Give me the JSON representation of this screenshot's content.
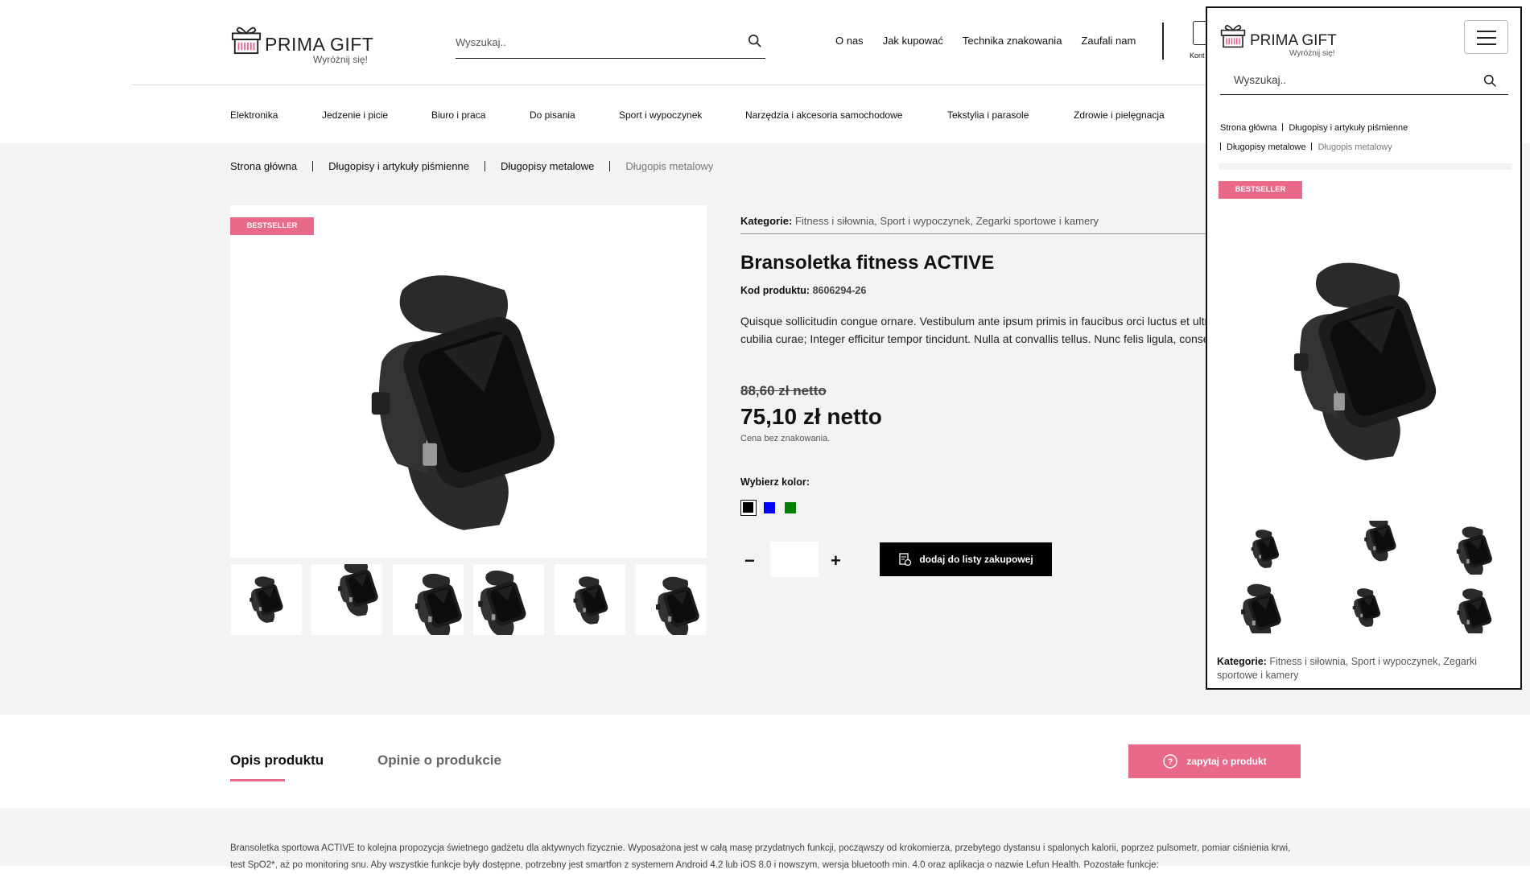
{
  "header": {
    "brand": "PRIMA GIFT",
    "tagline": "Wyróżnij się!",
    "search_placeholder": "Wyszukaj..",
    "nav": [
      "O nas",
      "Jak kupować",
      "Technika znakowania",
      "Zaufali nam"
    ],
    "cart_label": "Kont"
  },
  "categories_nav": [
    "Elektronika",
    "Jedzenie i picie",
    "Biuro i praca",
    "Do pisania",
    "Sport i wypoczynek",
    "Narzędzia i akcesoria samochodowe",
    "Tekstylia i parasole",
    "Zdrowie i pielęgnacja"
  ],
  "breadcrumb": [
    "Strona główna",
    "Długopisy i artykuły piśmienne",
    "Długopisy metalowe",
    "Długopis metalowy"
  ],
  "product": {
    "badge": "BESTSELLER",
    "categories_label": "Kategorie:",
    "categories_value": "Fitness i siłownia, Sport i wypoczynek, Zegarki sportowe i kamery",
    "title": "Bransoletka fitness ACTIVE",
    "code_label": "Kod produktu:",
    "code_value": "8606294-26",
    "description_line1": "Quisque sollicitudin congue ornare. Vestibulum ante ipsum primis in faucibus orci luctus et ultrices posuere",
    "description_line2": "cubilia curae; Integer efficitur tempor tincidunt. Nulla at convallis tellus. Nunc felis ligula, consectetur at",
    "old_price": "88,60 zł netto",
    "price": "75,10 zł netto",
    "price_note": "Cena bez znakowania.",
    "color_label": "Wybierz kolor:",
    "colors": [
      "#000000",
      "#0000ff",
      "#008000"
    ],
    "quantity_minus": "−",
    "quantity_plus": "+",
    "add_button": "dodaj do listy zakupowej"
  },
  "tabs": {
    "description": "Opis produktu",
    "reviews": "Opinie o produkcie",
    "ask_button": "zapytaj o produkt"
  },
  "long_description": "Bransoletka sportowa ACTIVE to kolejna propozycja świetnego gadżetu dla aktywnych fizycznie. Wyposażona jest w całą masę przydatnych funkcji, począwszy od krokomierza, przebytego dystansu i spalonych kalorii, poprzez pulsometr, pomiar ciśnienia krwi, test SpO2*, aż po monitoring snu. Aby wszystkie funkcje były dostępne, potrzebny jest smartfon z systemem Android 4.2 lub iOS 8.0 i nowszym, wersja bluetooth min. 4.0 oraz aplikacja o nazwie Lefun Health. Pozostałe funkcje:",
  "mobile": {
    "brand": "PRIMA GIFT",
    "tagline": "Wyróżnij się!",
    "search_placeholder": "Wyszukaj..",
    "crumb_line1_a": "Strona główna",
    "crumb_line1_b": "Długopisy i artykuły piśmienne",
    "crumb_line2_a": "Długopisy metalowe",
    "crumb_line2_b": "Długopis metalowy",
    "badge": "BESTSELLER",
    "categories_label": "Kategorie:",
    "categories_value": "Fitness i siłownia, Sport i wypoczynek, Zegarki sportowe i kamery"
  },
  "colors": {
    "accent": "#e9698a",
    "background": "#f3f3f3",
    "button": "#000000"
  }
}
